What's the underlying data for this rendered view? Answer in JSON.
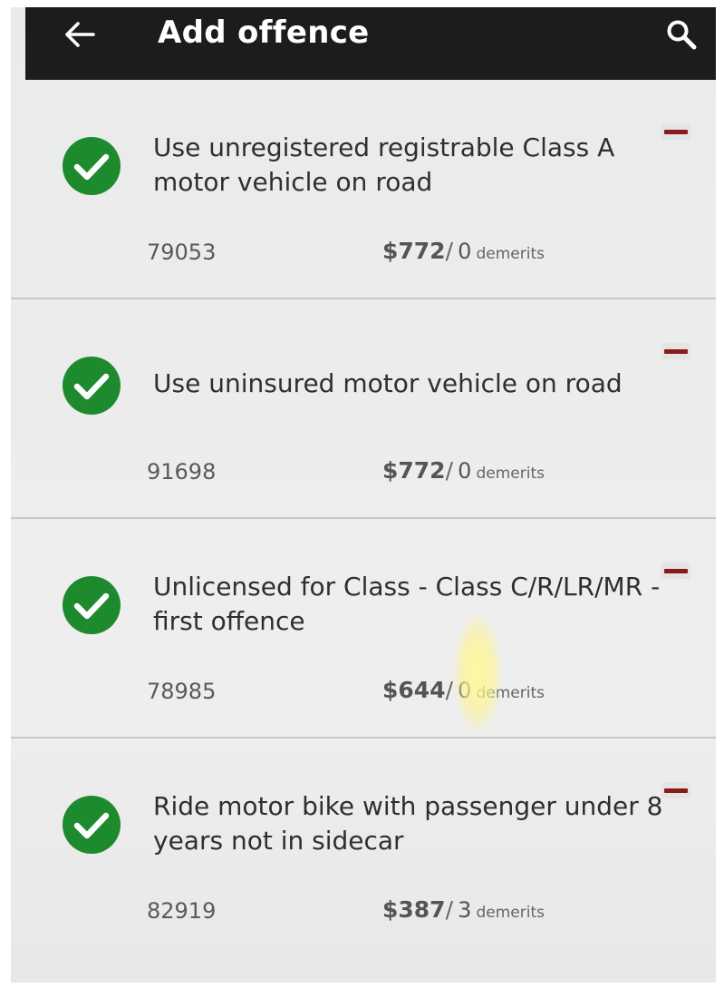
{
  "appbar": {
    "title": "Add offence",
    "back_icon": "arrow-left-icon",
    "search_icon": "search-icon",
    "background": "#1c1c1c"
  },
  "colors": {
    "check_green": "#1e8a2e",
    "remove_red": "#8b1a1a"
  },
  "offences": [
    {
      "title": "Use unregistered registrable Class A motor vehicle on road",
      "code": "79053",
      "fee": "$772",
      "separator": "/",
      "demerits": "0",
      "demerits_label": "demerits"
    },
    {
      "title": "Use uninsured motor vehicle on road",
      "code": "91698",
      "fee": "$772",
      "separator": "/",
      "demerits": "0",
      "demerits_label": "demerits"
    },
    {
      "title": "Unlicensed for Class - Class C/R/LR/MR - first offence",
      "code": "78985",
      "fee": "$644",
      "separator": "/",
      "demerits": "0",
      "demerits_label": "demerits"
    },
    {
      "title": "Ride motor bike with passenger under 8 years not in sidecar",
      "code": "82919",
      "fee": "$387",
      "separator": "/",
      "demerits": "3",
      "demerits_label": "demerits"
    }
  ]
}
